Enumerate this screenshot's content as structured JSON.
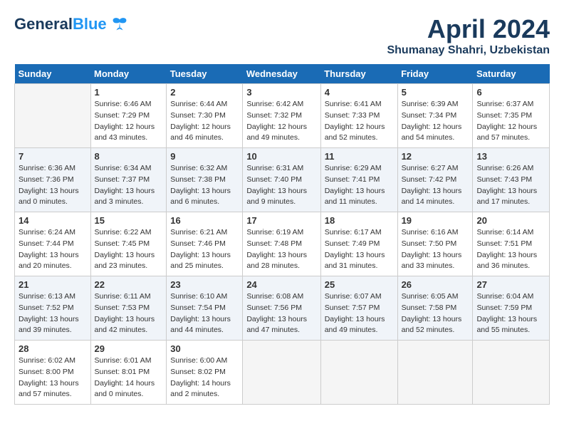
{
  "logo": {
    "general": "General",
    "blue": "Blue",
    "tagline": ""
  },
  "header": {
    "month_year": "April 2024",
    "location": "Shumanay Shahri, Uzbekistan"
  },
  "days_of_week": [
    "Sunday",
    "Monday",
    "Tuesday",
    "Wednesday",
    "Thursday",
    "Friday",
    "Saturday"
  ],
  "weeks": [
    [
      {
        "day": "",
        "sunrise": "",
        "sunset": "",
        "daylight": ""
      },
      {
        "day": "1",
        "sunrise": "Sunrise: 6:46 AM",
        "sunset": "Sunset: 7:29 PM",
        "daylight": "Daylight: 12 hours and 43 minutes."
      },
      {
        "day": "2",
        "sunrise": "Sunrise: 6:44 AM",
        "sunset": "Sunset: 7:30 PM",
        "daylight": "Daylight: 12 hours and 46 minutes."
      },
      {
        "day": "3",
        "sunrise": "Sunrise: 6:42 AM",
        "sunset": "Sunset: 7:32 PM",
        "daylight": "Daylight: 12 hours and 49 minutes."
      },
      {
        "day": "4",
        "sunrise": "Sunrise: 6:41 AM",
        "sunset": "Sunset: 7:33 PM",
        "daylight": "Daylight: 12 hours and 52 minutes."
      },
      {
        "day": "5",
        "sunrise": "Sunrise: 6:39 AM",
        "sunset": "Sunset: 7:34 PM",
        "daylight": "Daylight: 12 hours and 54 minutes."
      },
      {
        "day": "6",
        "sunrise": "Sunrise: 6:37 AM",
        "sunset": "Sunset: 7:35 PM",
        "daylight": "Daylight: 12 hours and 57 minutes."
      }
    ],
    [
      {
        "day": "7",
        "sunrise": "Sunrise: 6:36 AM",
        "sunset": "Sunset: 7:36 PM",
        "daylight": "Daylight: 13 hours and 0 minutes."
      },
      {
        "day": "8",
        "sunrise": "Sunrise: 6:34 AM",
        "sunset": "Sunset: 7:37 PM",
        "daylight": "Daylight: 13 hours and 3 minutes."
      },
      {
        "day": "9",
        "sunrise": "Sunrise: 6:32 AM",
        "sunset": "Sunset: 7:38 PM",
        "daylight": "Daylight: 13 hours and 6 minutes."
      },
      {
        "day": "10",
        "sunrise": "Sunrise: 6:31 AM",
        "sunset": "Sunset: 7:40 PM",
        "daylight": "Daylight: 13 hours and 9 minutes."
      },
      {
        "day": "11",
        "sunrise": "Sunrise: 6:29 AM",
        "sunset": "Sunset: 7:41 PM",
        "daylight": "Daylight: 13 hours and 11 minutes."
      },
      {
        "day": "12",
        "sunrise": "Sunrise: 6:27 AM",
        "sunset": "Sunset: 7:42 PM",
        "daylight": "Daylight: 13 hours and 14 minutes."
      },
      {
        "day": "13",
        "sunrise": "Sunrise: 6:26 AM",
        "sunset": "Sunset: 7:43 PM",
        "daylight": "Daylight: 13 hours and 17 minutes."
      }
    ],
    [
      {
        "day": "14",
        "sunrise": "Sunrise: 6:24 AM",
        "sunset": "Sunset: 7:44 PM",
        "daylight": "Daylight: 13 hours and 20 minutes."
      },
      {
        "day": "15",
        "sunrise": "Sunrise: 6:22 AM",
        "sunset": "Sunset: 7:45 PM",
        "daylight": "Daylight: 13 hours and 23 minutes."
      },
      {
        "day": "16",
        "sunrise": "Sunrise: 6:21 AM",
        "sunset": "Sunset: 7:46 PM",
        "daylight": "Daylight: 13 hours and 25 minutes."
      },
      {
        "day": "17",
        "sunrise": "Sunrise: 6:19 AM",
        "sunset": "Sunset: 7:48 PM",
        "daylight": "Daylight: 13 hours and 28 minutes."
      },
      {
        "day": "18",
        "sunrise": "Sunrise: 6:17 AM",
        "sunset": "Sunset: 7:49 PM",
        "daylight": "Daylight: 13 hours and 31 minutes."
      },
      {
        "day": "19",
        "sunrise": "Sunrise: 6:16 AM",
        "sunset": "Sunset: 7:50 PM",
        "daylight": "Daylight: 13 hours and 33 minutes."
      },
      {
        "day": "20",
        "sunrise": "Sunrise: 6:14 AM",
        "sunset": "Sunset: 7:51 PM",
        "daylight": "Daylight: 13 hours and 36 minutes."
      }
    ],
    [
      {
        "day": "21",
        "sunrise": "Sunrise: 6:13 AM",
        "sunset": "Sunset: 7:52 PM",
        "daylight": "Daylight: 13 hours and 39 minutes."
      },
      {
        "day": "22",
        "sunrise": "Sunrise: 6:11 AM",
        "sunset": "Sunset: 7:53 PM",
        "daylight": "Daylight: 13 hours and 42 minutes."
      },
      {
        "day": "23",
        "sunrise": "Sunrise: 6:10 AM",
        "sunset": "Sunset: 7:54 PM",
        "daylight": "Daylight: 13 hours and 44 minutes."
      },
      {
        "day": "24",
        "sunrise": "Sunrise: 6:08 AM",
        "sunset": "Sunset: 7:56 PM",
        "daylight": "Daylight: 13 hours and 47 minutes."
      },
      {
        "day": "25",
        "sunrise": "Sunrise: 6:07 AM",
        "sunset": "Sunset: 7:57 PM",
        "daylight": "Daylight: 13 hours and 49 minutes."
      },
      {
        "day": "26",
        "sunrise": "Sunrise: 6:05 AM",
        "sunset": "Sunset: 7:58 PM",
        "daylight": "Daylight: 13 hours and 52 minutes."
      },
      {
        "day": "27",
        "sunrise": "Sunrise: 6:04 AM",
        "sunset": "Sunset: 7:59 PM",
        "daylight": "Daylight: 13 hours and 55 minutes."
      }
    ],
    [
      {
        "day": "28",
        "sunrise": "Sunrise: 6:02 AM",
        "sunset": "Sunset: 8:00 PM",
        "daylight": "Daylight: 13 hours and 57 minutes."
      },
      {
        "day": "29",
        "sunrise": "Sunrise: 6:01 AM",
        "sunset": "Sunset: 8:01 PM",
        "daylight": "Daylight: 14 hours and 0 minutes."
      },
      {
        "day": "30",
        "sunrise": "Sunrise: 6:00 AM",
        "sunset": "Sunset: 8:02 PM",
        "daylight": "Daylight: 14 hours and 2 minutes."
      },
      {
        "day": "",
        "sunrise": "",
        "sunset": "",
        "daylight": ""
      },
      {
        "day": "",
        "sunrise": "",
        "sunset": "",
        "daylight": ""
      },
      {
        "day": "",
        "sunrise": "",
        "sunset": "",
        "daylight": ""
      },
      {
        "day": "",
        "sunrise": "",
        "sunset": "",
        "daylight": ""
      }
    ]
  ]
}
